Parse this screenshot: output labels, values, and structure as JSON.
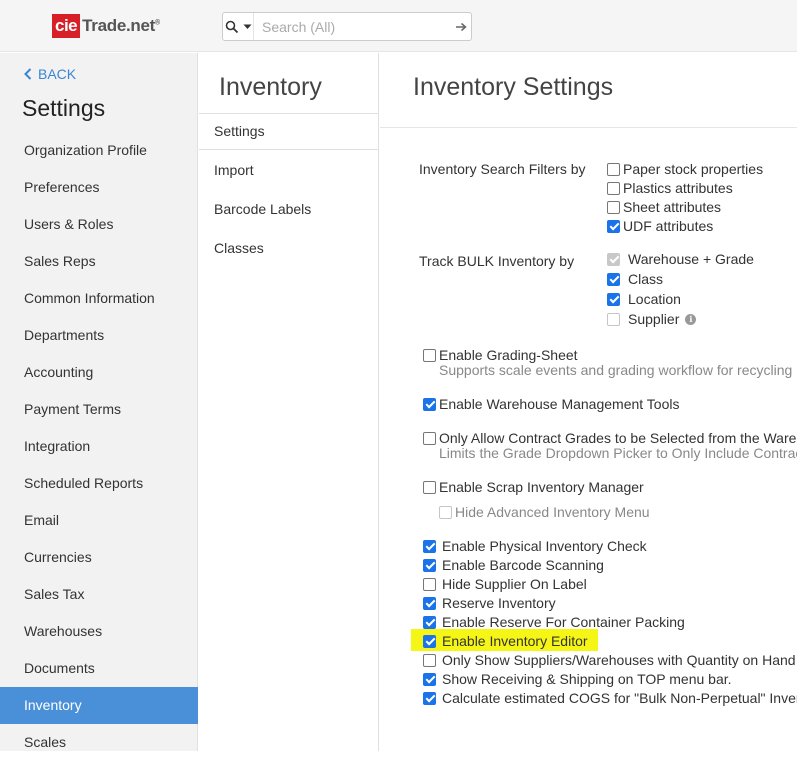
{
  "header": {
    "logo": {
      "part1": "cie",
      "part2": "Trade.net",
      "reg": "®"
    },
    "search": {
      "placeholder": "Search (All)"
    }
  },
  "sidebar": {
    "back_label": "BACK",
    "title": "Settings",
    "items": [
      {
        "label": "Organization Profile"
      },
      {
        "label": "Preferences"
      },
      {
        "label": "Users & Roles"
      },
      {
        "label": "Sales Reps"
      },
      {
        "label": "Common Information"
      },
      {
        "label": "Departments"
      },
      {
        "label": "Accounting"
      },
      {
        "label": "Payment Terms"
      },
      {
        "label": "Integration"
      },
      {
        "label": "Scheduled Reports"
      },
      {
        "label": "Email"
      },
      {
        "label": "Currencies"
      },
      {
        "label": "Sales Tax"
      },
      {
        "label": "Warehouses"
      },
      {
        "label": "Documents"
      },
      {
        "label": "Inventory"
      },
      {
        "label": "Scales"
      }
    ],
    "active": "Inventory"
  },
  "subnav": {
    "title": "Inventory",
    "items": [
      {
        "label": "Settings"
      },
      {
        "label": "Import"
      },
      {
        "label": "Barcode Labels"
      },
      {
        "label": "Classes"
      }
    ],
    "active": "Settings"
  },
  "main": {
    "title": "Inventory Settings",
    "search_filters": {
      "label": "Inventory Search Filters by",
      "options": [
        {
          "label": "Paper stock properties",
          "checked": false
        },
        {
          "label": "Plastics attributes",
          "checked": false
        },
        {
          "label": "Sheet attributes",
          "checked": false
        },
        {
          "label": "UDF attributes",
          "checked": true
        }
      ]
    },
    "track_bulk": {
      "label": "Track BULK Inventory by",
      "options": [
        {
          "label": "Warehouse + Grade",
          "checked": true,
          "disabled": true
        },
        {
          "label": "Class",
          "checked": true
        },
        {
          "label": "Location",
          "checked": true
        },
        {
          "label": "Supplier",
          "checked": false,
          "disabled": true
        }
      ]
    },
    "grading_sheet": {
      "label": "Enable Grading-Sheet",
      "checked": false,
      "desc": "Supports scale events and grading workflow for recycling p"
    },
    "warehouse_tools": {
      "label": "Enable Warehouse Management Tools",
      "checked": true
    },
    "contract_grades": {
      "label": "Only Allow Contract Grades to be Selected from the Wareh",
      "checked": false,
      "desc": "Limits the Grade Dropdown Picker to Only Include Contrac"
    },
    "scrap_manager": {
      "label": "Enable Scrap Inventory Manager",
      "checked": false
    },
    "hide_advanced": {
      "label": "Hide Advanced Inventory Menu",
      "checked": false,
      "disabled": true
    },
    "options": [
      {
        "label": "Enable Physical Inventory Check",
        "checked": true
      },
      {
        "label": "Enable Barcode Scanning",
        "checked": true
      },
      {
        "label": "Hide Supplier On Label",
        "checked": false
      },
      {
        "label": "Reserve Inventory",
        "checked": true
      },
      {
        "label": "Enable Reserve For Container Packing",
        "checked": true
      },
      {
        "label": "Enable Inventory Editor",
        "checked": true,
        "highlighted": true
      },
      {
        "label": "Only Show Suppliers/Warehouses with Quantity on Hand o",
        "checked": false
      },
      {
        "label": "Show Receiving & Shipping on TOP menu bar.",
        "checked": true
      },
      {
        "label": "Calculate estimated COGS for \"Bulk Non-Perpetual\" Invent",
        "checked": true
      }
    ]
  },
  "colors": {
    "accent": "#4a90d9",
    "checkbox": "#1a73e8",
    "highlight": "#f5f516",
    "logo_red": "#d71f28",
    "link": "#3a86d4"
  },
  "icons": [
    "search-icon",
    "chevron-down-icon",
    "arrow-right-icon",
    "chevron-left-icon",
    "info-icon"
  ]
}
